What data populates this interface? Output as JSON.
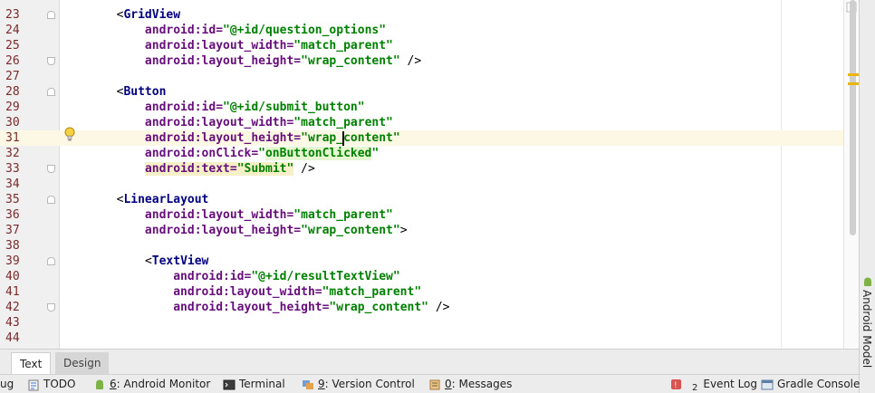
{
  "editor": {
    "lines": [
      {
        "num": "23",
        "tokens": [
          {
            "t": "    ",
            "c": "tok-punct"
          },
          {
            "t": "<",
            "c": "tok-punct"
          },
          {
            "t": "GridView",
            "c": "tok-tag"
          }
        ]
      },
      {
        "num": "24",
        "tokens": [
          {
            "t": "        android:id=",
            "c": "tok-attr"
          },
          {
            "t": "\"@+id/question_options\"",
            "c": "tok-val"
          }
        ]
      },
      {
        "num": "25",
        "tokens": [
          {
            "t": "        android:layout_width=",
            "c": "tok-attr"
          },
          {
            "t": "\"match_parent\"",
            "c": "tok-val"
          }
        ]
      },
      {
        "num": "26",
        "tokens": [
          {
            "t": "        android:layout_height=",
            "c": "tok-attr"
          },
          {
            "t": "\"wrap_content\"",
            "c": "tok-val"
          },
          {
            "t": " />",
            "c": "tok-punct"
          }
        ]
      },
      {
        "num": "27",
        "tokens": []
      },
      {
        "num": "28",
        "tokens": [
          {
            "t": "    ",
            "c": "tok-punct"
          },
          {
            "t": "<",
            "c": "tok-punct"
          },
          {
            "t": "Button",
            "c": "tok-tag"
          }
        ]
      },
      {
        "num": "29",
        "tokens": [
          {
            "t": "        android:id=",
            "c": "tok-attr"
          },
          {
            "t": "\"@+id/submit_button\"",
            "c": "tok-val"
          }
        ]
      },
      {
        "num": "30",
        "tokens": [
          {
            "t": "        android:layout_width=",
            "c": "tok-attr"
          },
          {
            "t": "\"match_parent\"",
            "c": "tok-val"
          }
        ]
      },
      {
        "num": "31",
        "tokens": [
          {
            "t": "        android:layout_height=",
            "c": "tok-attr"
          },
          {
            "t": "\"wrap_content\"",
            "c": "tok-val"
          }
        ],
        "current": true
      },
      {
        "num": "32",
        "tokens": [
          {
            "t": "        android:onClick=",
            "c": "tok-attr"
          },
          {
            "t": "\"",
            "c": "tok-val"
          },
          {
            "t": "onButtonClicked",
            "c": "tok-val hl-green"
          },
          {
            "t": "\"",
            "c": "tok-val"
          }
        ]
      },
      {
        "num": "33",
        "tokens": [
          {
            "t": "        ",
            "c": "tok-punct"
          },
          {
            "t": "android:text=",
            "c": "tok-attr hl-yellow"
          },
          {
            "t": "\"Submit\"",
            "c": "tok-val hl-yellow"
          },
          {
            "t": " />",
            "c": "tok-punct"
          }
        ]
      },
      {
        "num": "34",
        "tokens": []
      },
      {
        "num": "35",
        "tokens": [
          {
            "t": "    ",
            "c": "tok-punct"
          },
          {
            "t": "<",
            "c": "tok-punct"
          },
          {
            "t": "LinearLayout",
            "c": "tok-tag"
          }
        ]
      },
      {
        "num": "36",
        "tokens": [
          {
            "t": "        android:layout_width=",
            "c": "tok-attr"
          },
          {
            "t": "\"match_parent\"",
            "c": "tok-val"
          }
        ]
      },
      {
        "num": "37",
        "tokens": [
          {
            "t": "        android:layout_height=",
            "c": "tok-attr"
          },
          {
            "t": "\"wrap_content\"",
            "c": "tok-val"
          },
          {
            "t": ">",
            "c": "tok-punct"
          }
        ]
      },
      {
        "num": "38",
        "tokens": []
      },
      {
        "num": "39",
        "tokens": [
          {
            "t": "        ",
            "c": "tok-punct"
          },
          {
            "t": "<",
            "c": "tok-punct"
          },
          {
            "t": "TextView",
            "c": "tok-tag"
          }
        ]
      },
      {
        "num": "40",
        "tokens": [
          {
            "t": "            android:id=",
            "c": "tok-attr"
          },
          {
            "t": "\"@+id/resultTextView\"",
            "c": "tok-val"
          }
        ]
      },
      {
        "num": "41",
        "tokens": [
          {
            "t": "            android:layout_width=",
            "c": "tok-attr"
          },
          {
            "t": "\"match_parent\"",
            "c": "tok-val"
          }
        ]
      },
      {
        "num": "42",
        "tokens": [
          {
            "t": "            android:layout_height=",
            "c": "tok-attr"
          },
          {
            "t": "\"wrap_content\"",
            "c": "tok-val"
          },
          {
            "t": " />",
            "c": "tok-punct"
          }
        ]
      },
      {
        "num": "43",
        "tokens": []
      },
      {
        "num": "44",
        "tokens": []
      }
    ],
    "caret_line": "31",
    "caret_col": 36
  },
  "editor_tabs": {
    "text": "Text",
    "design": "Design"
  },
  "right_toolbar": {
    "android_model": "Android Model"
  },
  "statusbar": {
    "debug_partial": "ug",
    "todo": "TODO",
    "android_monitor_num": "6",
    "android_monitor": ": Android Monitor",
    "terminal": "Terminal",
    "version_control_num": "9",
    "version_control": ": Version Control",
    "messages_num": "0",
    "messages": ": Messages",
    "event_log_badge": "2",
    "event_log": "Event Log",
    "gradle_console": "Gradle Console"
  },
  "colors": {
    "tag": "#000080",
    "attr": "#660e7a",
    "value": "#008000",
    "current_line": "#fdf8e4",
    "line_number": "#7a2a2a"
  }
}
